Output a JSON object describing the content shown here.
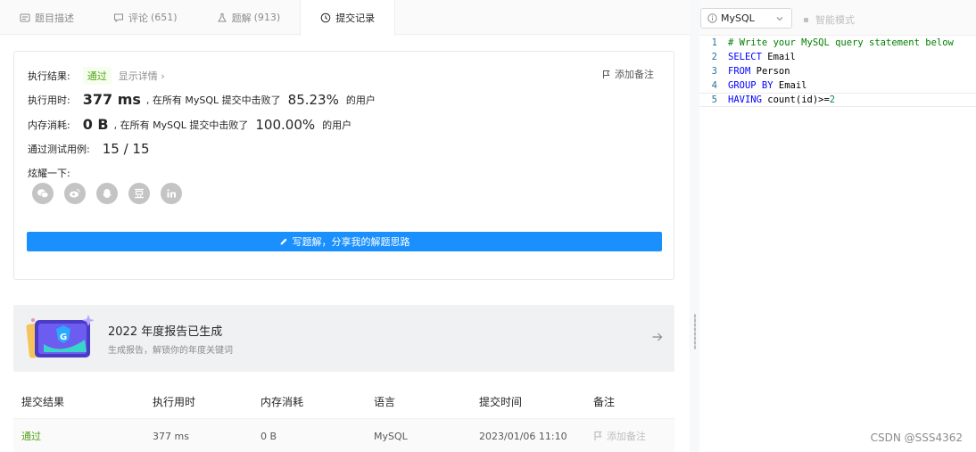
{
  "tabs": [
    {
      "label": "题目描述",
      "count": "",
      "icon": "document-icon"
    },
    {
      "label": "评论",
      "count": "(651)",
      "icon": "comment-icon"
    },
    {
      "label": "题解",
      "count": "(913)",
      "icon": "flask-icon"
    },
    {
      "label": "提交记录",
      "count": "",
      "icon": "clock-icon"
    }
  ],
  "result": {
    "label": "执行结果:",
    "status": "通过",
    "detail_link": "显示详情 ›",
    "add_note": "添加备注",
    "runtime": {
      "label": "执行用时:",
      "value": "377 ms",
      "mid": ", 在所有 MySQL 提交中击败了",
      "percent": "85.23%",
      "suffix": "的用户"
    },
    "memory": {
      "label": "内存消耗:",
      "value": "0 B",
      "mid": ", 在所有 MySQL 提交中击败了",
      "percent": "100.00%",
      "suffix": "的用户"
    },
    "tests": {
      "label": "通过测试用例:",
      "value": "15 / 15"
    },
    "share_label": "炫耀一下:",
    "share_icons": [
      "wechat-icon",
      "weibo-icon",
      "qq-icon",
      "douban-icon",
      "linkedin-icon"
    ],
    "write_button": "写题解，分享我的解题思路"
  },
  "banner": {
    "title": "2022 年度报告已生成",
    "subtitle": "生成报告，解锁你的年度关键词"
  },
  "table": {
    "headers": [
      "提交结果",
      "执行用时",
      "内存消耗",
      "语言",
      "提交时间",
      "备注"
    ],
    "rows": [
      {
        "result": "通过",
        "runtime": "377 ms",
        "memory": "0 B",
        "language": "MySQL",
        "time": "2023/01/06 11:10",
        "note": "添加备注"
      }
    ]
  },
  "editor": {
    "language": "MySQL",
    "smart_mode": "智能模式",
    "lines": [
      {
        "n": "1",
        "parts": [
          {
            "t": "# Write your MySQL query statement below",
            "c": "cm"
          }
        ]
      },
      {
        "n": "2",
        "parts": [
          {
            "t": "SELECT",
            "c": "kw"
          },
          {
            "t": " Email",
            "c": "tx"
          }
        ]
      },
      {
        "n": "3",
        "parts": [
          {
            "t": "FROM",
            "c": "kw"
          },
          {
            "t": " Person",
            "c": "tx"
          }
        ]
      },
      {
        "n": "4",
        "parts": [
          {
            "t": "GROUP BY",
            "c": "kw"
          },
          {
            "t": " Email",
            "c": "tx"
          }
        ]
      },
      {
        "n": "5",
        "parts": [
          {
            "t": "HAVING",
            "c": "kw"
          },
          {
            "t": " count(id)>=",
            "c": "tx"
          },
          {
            "t": "2",
            "c": "num"
          }
        ]
      }
    ]
  },
  "watermark": "CSDN @SSS4362",
  "colors": {
    "accent": "#1a90ff",
    "success": "#52a318",
    "keyword": "#0000ff",
    "comment": "#008000"
  }
}
